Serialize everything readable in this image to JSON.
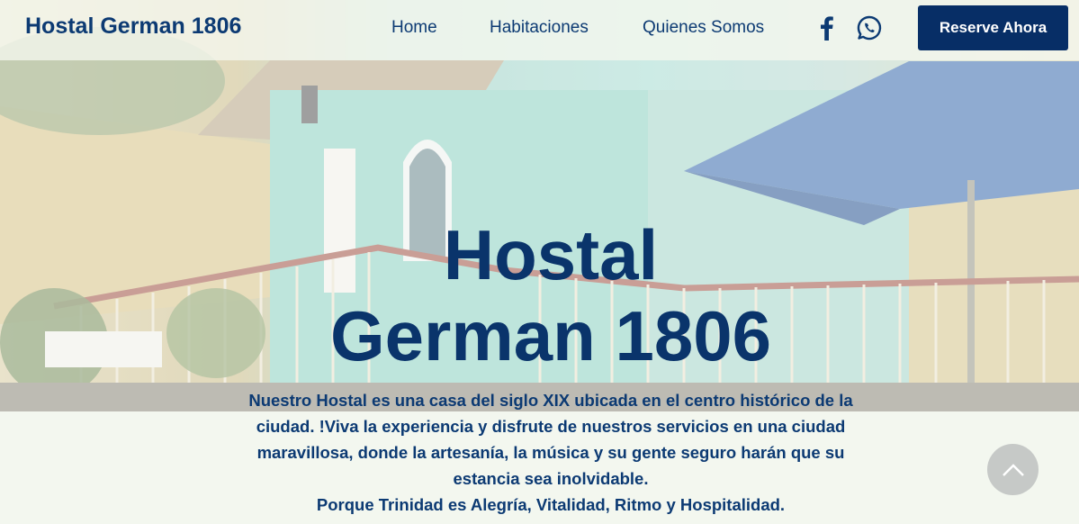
{
  "navbar": {
    "brand": "Hostal German 1806",
    "links": [
      "Home",
      "Habitaciones",
      "Quienes Somos"
    ],
    "social": {
      "facebook_icon": "facebook-icon",
      "whatsapp_icon": "whatsapp-icon"
    },
    "cta": "Reserve Ahora"
  },
  "hero": {
    "title_line1": "Hostal",
    "title_line2": "German 1806",
    "description": [
      "Nuestro Hostal es una casa del siglo XIX ubicada en el centro histórico de la",
      "ciudad. !Viva la experiencia y disfrute de nuestros servicios en una ciudad",
      "maravillosa, donde la artesanía, la música y su gente seguro harán que su",
      "estancia sea inolvidable.",
      "Porque Trinidad es Alegría, Vitalidad, Ritmo y Hospitalidad."
    ]
  },
  "scroll_top_icon": "chevron-up-icon",
  "colors": {
    "brand": "#0c3a73",
    "cta_bg": "#072e66",
    "page_bg": "#f3f7ef"
  }
}
